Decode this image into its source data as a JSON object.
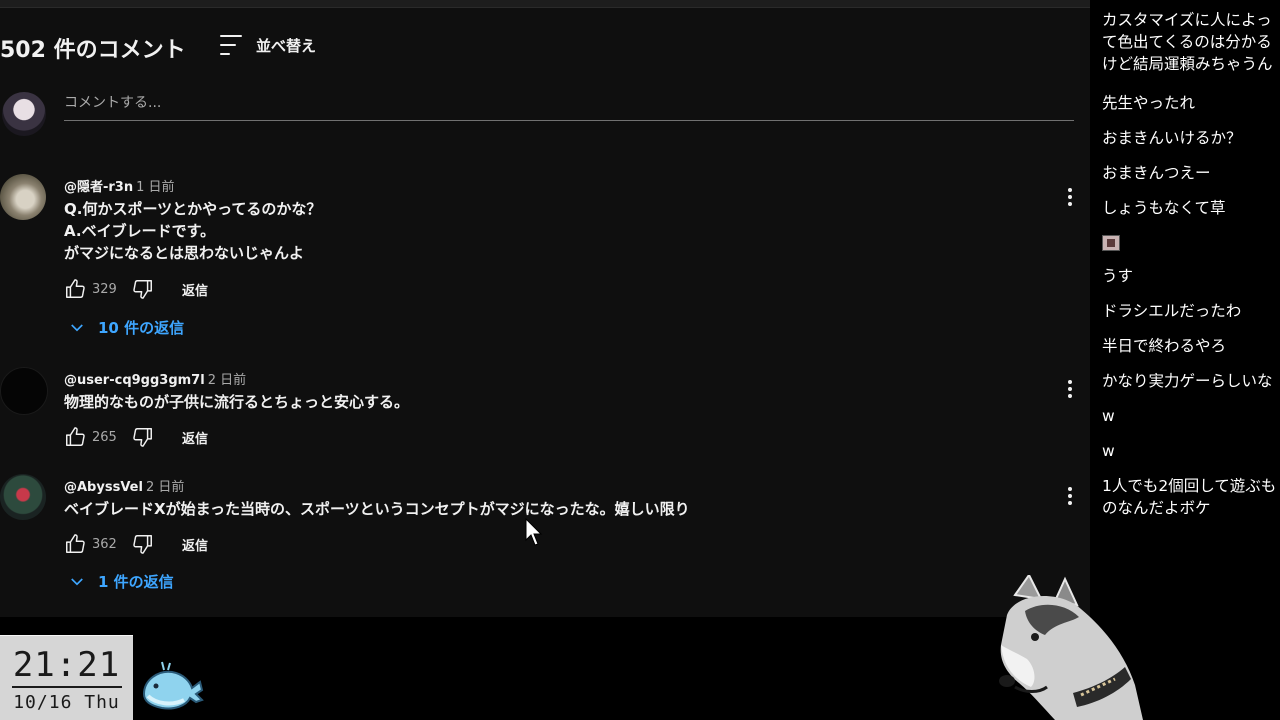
{
  "comments": {
    "count_label": "502 件のコメント",
    "sort_label": "並べ替え",
    "add_placeholder": "コメントする...",
    "threads": [
      {
        "author": "@隠者-r3n",
        "time": "1 日前",
        "lines": [
          "Q.何かスポーツとかやってるのかな？",
          "A.ベイブレードです。",
          "がマジになるとは思わないじゃんよ"
        ],
        "likes": "329",
        "reply_label": "返信",
        "replies_toggle": "10 件の返信"
      },
      {
        "author": "@user-cq9gg3gm7l",
        "time": "2 日前",
        "lines": [
          "物理的なものが子供に流行るとちょっと安心する。"
        ],
        "likes": "265",
        "reply_label": "返信",
        "replies_toggle": ""
      },
      {
        "author": "@AbyssVel",
        "time": "2 日前",
        "lines": [
          "ベイブレードXが始まった当時の、スポーツというコンセプトがマジになったな。嬉しい限り"
        ],
        "likes": "362",
        "reply_label": "返信",
        "replies_toggle": "1 件の返信"
      }
    ]
  },
  "chat": [
    "カスタマイズに人によって色出てくるのは分かるけど結局運頼みちゃうん",
    "先生やったれ",
    "おまきんいけるか？",
    "おまきんつえー",
    "しょうもなくて草",
    "",
    "うす",
    "ドラシエルだったわ",
    "半日で終わるやろ",
    "かなり実力ゲーらしいな",
    "w",
    "w",
    "1人でも2個回して遊ぶものなんだよボケ"
  ],
  "clock": {
    "time": "21:21",
    "date": "10/16 Thu"
  },
  "colors": {
    "background": "#0f0f0f",
    "link_blue": "#3ea6ff",
    "secondary_text": "#aaaaaa"
  },
  "icons": [
    "sort-icon",
    "like-icon",
    "dislike-icon",
    "more-vert-icon",
    "chevron-down-icon",
    "mouse-cursor-icon"
  ]
}
